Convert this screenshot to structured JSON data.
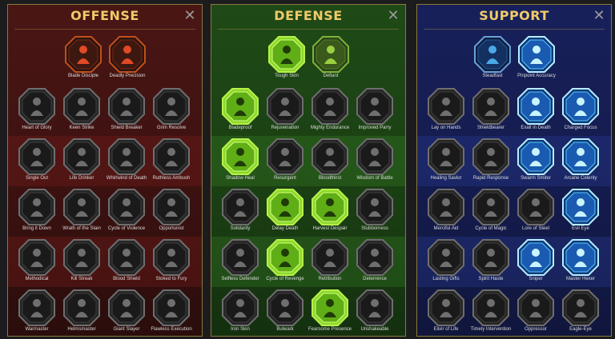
{
  "panels": [
    {
      "key": "offense",
      "title": "OFFENSE",
      "accent": "#f0ca6a",
      "top": [
        {
          "label": "Blade Disciple",
          "icon": "crossed-swords-icon",
          "state": "red"
        },
        {
          "label": "Deadly Precision",
          "icon": "claw-slash-icon",
          "state": "red"
        }
      ],
      "rows": [
        [
          {
            "label": "Heart of Glory",
            "icon": "warrior-figure-icon"
          },
          {
            "label": "Keen Strike",
            "icon": "slash-icon"
          },
          {
            "label": "Shield Breaker",
            "icon": "broken-shield-icon"
          },
          {
            "label": "Grim Resolve",
            "icon": "heart-icon"
          }
        ],
        [
          {
            "label": "Single Out",
            "icon": "fist-icon"
          },
          {
            "label": "Life Drinker",
            "icon": "fangs-icon"
          },
          {
            "label": "Whirlwind of Death",
            "icon": "whirlwind-icon"
          },
          {
            "label": "Ruthless Ambush",
            "icon": "ambush-icon"
          }
        ],
        [
          {
            "label": "Bring it Down",
            "icon": "falling-icon"
          },
          {
            "label": "Wrath of the Slain",
            "icon": "raised-fist-icon"
          },
          {
            "label": "Cycle of Violence",
            "icon": "cycle-icon"
          },
          {
            "label": "Opportunist",
            "icon": "chain-icon"
          }
        ],
        [
          {
            "label": "Methodical",
            "icon": "spikes-icon"
          },
          {
            "label": "Kill Streak",
            "icon": "skull-icon"
          },
          {
            "label": "Blood Shield",
            "icon": "blood-shield-icon"
          },
          {
            "label": "Stoked to Fury",
            "icon": "flame-figure-icon"
          }
        ],
        [
          {
            "label": "Warmaster",
            "icon": "sword-icon"
          },
          {
            "label": "Helmsmaster",
            "icon": "helmet-icon"
          },
          {
            "label": "Giant Slayer",
            "icon": "giant-icon"
          },
          {
            "label": "Flawless Execution",
            "icon": "executioner-skull-icon"
          }
        ]
      ]
    },
    {
      "key": "defense",
      "title": "DEFENSE",
      "accent": "#f0ca6a",
      "top": [
        {
          "label": "Tough Skin",
          "icon": "scale-armor-icon",
          "state": "lit"
        },
        {
          "label": "Defiant",
          "icon": "clenched-fist-icon",
          "state": "lit-dim"
        }
      ],
      "rows": [
        [
          {
            "label": "Bladeproof",
            "icon": "shield-chevron-icon",
            "state": "lit"
          },
          {
            "label": "Rejuvenation",
            "icon": "heart-icon"
          },
          {
            "label": "Mighty Endurance",
            "icon": "muscle-icon"
          },
          {
            "label": "Improved Parry",
            "icon": "parry-icon"
          }
        ],
        [
          {
            "label": "Shadow Heal",
            "icon": "running-figure-icon",
            "state": "lit"
          },
          {
            "label": "Resurgent",
            "icon": "resurgent-shield-icon"
          },
          {
            "label": "Bloodthirst",
            "icon": "heart-icon"
          },
          {
            "label": "Wisdom of Battle",
            "icon": "helmet-icon"
          }
        ],
        [
          {
            "label": "Solidarity",
            "icon": "crowd-icon"
          },
          {
            "label": "Delay Death",
            "icon": "hourglass-icon",
            "state": "lit"
          },
          {
            "label": "Harvest Despair",
            "icon": "open-hand-icon",
            "state": "lit"
          },
          {
            "label": "Stubborness",
            "icon": "bull-icon"
          }
        ],
        [
          {
            "label": "Selfless Defender",
            "icon": "defender-icon"
          },
          {
            "label": "Cycle of Revenge",
            "icon": "flames-icon",
            "state": "lit"
          },
          {
            "label": "Retribution",
            "icon": "sun-skull-icon"
          },
          {
            "label": "Deterrence",
            "icon": "deflect-icon"
          }
        ],
        [
          {
            "label": "Iron Skin",
            "icon": "iron-figure-icon"
          },
          {
            "label": "Bulwark",
            "icon": "bulwark-icon"
          },
          {
            "label": "Fearsome Presence",
            "icon": "fearsome-skull-icon",
            "state": "lit"
          },
          {
            "label": "Unshakeable",
            "icon": "standing-figure-icon"
          }
        ]
      ]
    },
    {
      "key": "support",
      "title": "SUPPORT",
      "accent": "#f0ca6a",
      "top": [
        {
          "label": "Steadfast",
          "icon": "hand-heart-icon",
          "state": "dim-blue"
        },
        {
          "label": "Pinpoint Accuracy",
          "icon": "target-hand-icon",
          "state": "blue"
        }
      ],
      "rows": [
        [
          {
            "label": "Lay on Hands",
            "icon": "praying-hands-icon"
          },
          {
            "label": "Shieldbearer",
            "icon": "arch-shield-icon"
          },
          {
            "label": "Exalt in Death",
            "icon": "blue-skull-icon",
            "state": "blue"
          },
          {
            "label": "Charged Focus",
            "icon": "charged-hand-icon",
            "state": "blue"
          }
        ],
        [
          {
            "label": "Healing Savior",
            "icon": "healer-figure-icon"
          },
          {
            "label": "Rapid Response",
            "icon": "lightning-icon"
          },
          {
            "label": "Swarm Smiter",
            "icon": "swarm-icon",
            "state": "blue"
          },
          {
            "label": "Arcane Celerity",
            "icon": "arcane-figure-icon",
            "state": "blue"
          }
        ],
        [
          {
            "label": "Merciful Aid",
            "icon": "heart-chain-icon"
          },
          {
            "label": "Cycle of Magic",
            "icon": "cycle-icon"
          },
          {
            "label": "Lore of Steel",
            "icon": "book-icon"
          },
          {
            "label": "Evil Eye",
            "icon": "evil-face-icon",
            "state": "blue"
          }
        ],
        [
          {
            "label": "Lasting Gifts",
            "icon": "star-icon"
          },
          {
            "label": "Spirit Haste",
            "icon": "winged-boot-icon"
          },
          {
            "label": "Sniper",
            "icon": "eye-icon",
            "state": "blue"
          },
          {
            "label": "Master Hexer",
            "icon": "hex-figure-icon",
            "state": "blue"
          }
        ],
        [
          {
            "label": "Elixir of Life",
            "icon": "flask-icon"
          },
          {
            "label": "Timely Intervention",
            "icon": "skull-icon"
          },
          {
            "label": "Oppressor",
            "icon": "oppressor-icon"
          },
          {
            "label": "Eagle-Eye",
            "icon": "eagle-icon"
          }
        ]
      ]
    }
  ]
}
